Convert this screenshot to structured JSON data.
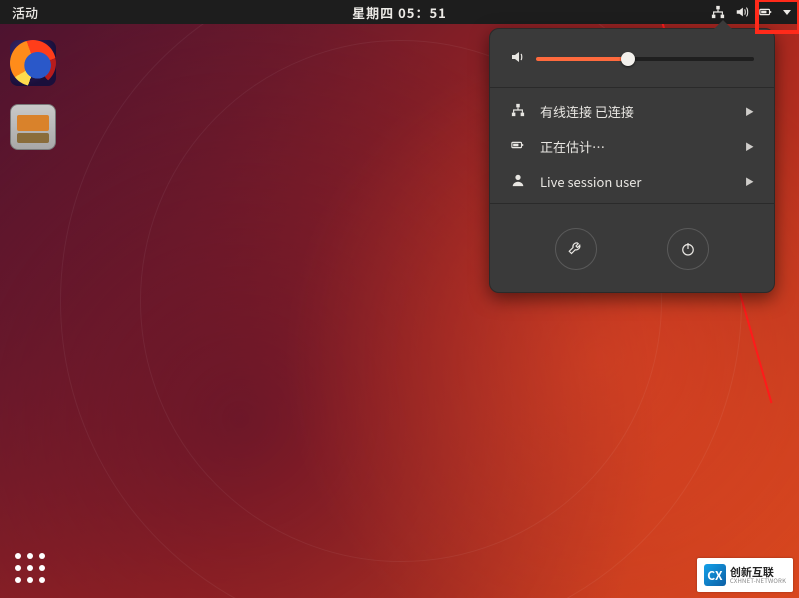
{
  "topbar": {
    "activities_label": "活动",
    "clock": "星期四 05：51"
  },
  "system_menu": {
    "volume_percent": 42,
    "items": [
      {
        "icon": "network-wired-icon",
        "label": "有线连接 已连接"
      },
      {
        "icon": "battery-icon",
        "label": "正在估计…"
      },
      {
        "icon": "user-icon",
        "label": "Live session user"
      }
    ],
    "settings_button": "设置",
    "power_button": "关机"
  },
  "dock": {
    "items": [
      {
        "name": "firefox",
        "tooltip": "Firefox 浏览器"
      },
      {
        "name": "file-manager",
        "tooltip": "文件"
      }
    ]
  },
  "watermark": {
    "logo_letters": "CX",
    "cn": "创新互联",
    "en": "CXHNET-NETWORK"
  }
}
